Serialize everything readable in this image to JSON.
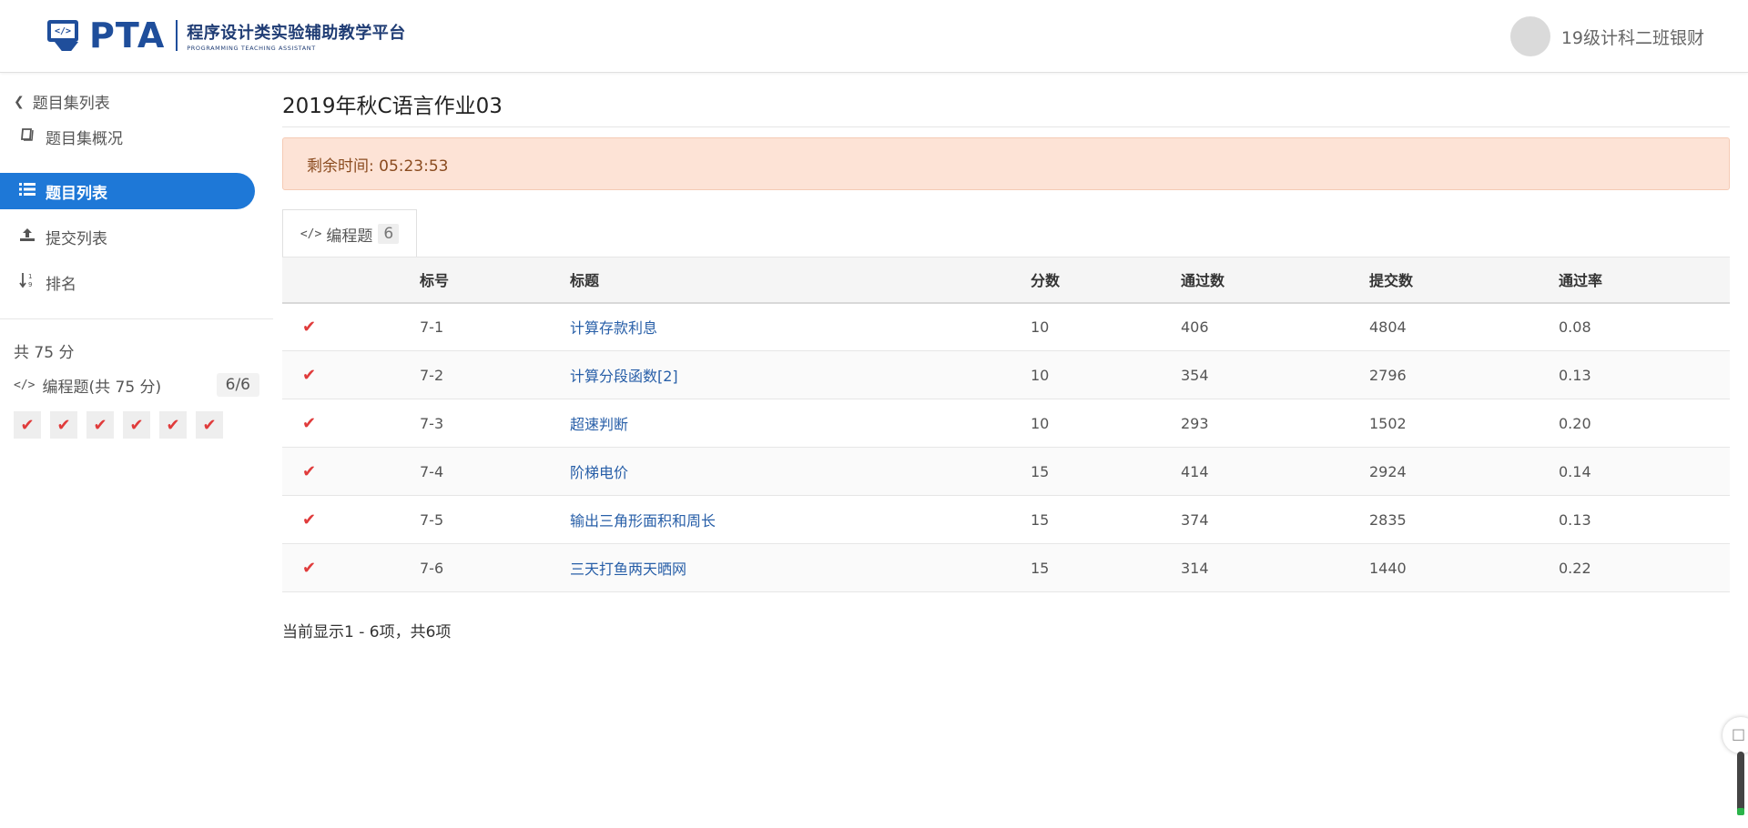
{
  "header": {
    "logo_text": "PTA",
    "logo_cn": "程序设计类实验辅助教学平台",
    "logo_en": "PROGRAMMING TEACHING ASSISTANT",
    "logo_code": "</>",
    "username": "19级计科二班银财"
  },
  "sidebar": {
    "back_label": "题目集列表",
    "items": [
      {
        "label": "题目集概况",
        "icon": "book-icon"
      },
      {
        "label": "题目列表",
        "icon": "list-icon",
        "active": true
      },
      {
        "label": "提交列表",
        "icon": "upload-icon"
      },
      {
        "label": "排名",
        "icon": "sort-icon"
      }
    ],
    "total_score": "共 75 分",
    "group": {
      "code": "</>",
      "label": "编程题(共 75 分)",
      "count": "6/6"
    },
    "check_mark": "✔"
  },
  "main": {
    "title": "2019年秋C语言作业03",
    "timer": "剩余时间: 05:23:53",
    "tab": {
      "code": "</>",
      "label": "编程题",
      "count": "6"
    },
    "columns": [
      "标号",
      "标题",
      "分数",
      "通过数",
      "提交数",
      "通过率"
    ],
    "rows": [
      {
        "check": "✔",
        "num": "7-1",
        "title": "计算存款利息",
        "score": "10",
        "passed": "406",
        "submitted": "4804",
        "rate": "0.08"
      },
      {
        "check": "✔",
        "num": "7-2",
        "title": "计算分段函数[2]",
        "score": "10",
        "passed": "354",
        "submitted": "2796",
        "rate": "0.13"
      },
      {
        "check": "✔",
        "num": "7-3",
        "title": "超速判断",
        "score": "10",
        "passed": "293",
        "submitted": "1502",
        "rate": "0.20"
      },
      {
        "check": "✔",
        "num": "7-4",
        "title": "阶梯电价",
        "score": "15",
        "passed": "414",
        "submitted": "2924",
        "rate": "0.14"
      },
      {
        "check": "✔",
        "num": "7-5",
        "title": "输出三角形面积和周长",
        "score": "15",
        "passed": "374",
        "submitted": "2835",
        "rate": "0.13"
      },
      {
        "check": "✔",
        "num": "7-6",
        "title": "三天打鱼两天晒网",
        "score": "15",
        "passed": "314",
        "submitted": "1440",
        "rate": "0.22"
      }
    ],
    "pager_info": "当前显示1 - 6项，共6项"
  },
  "colors": {
    "accent": "#1e78d7",
    "check": "#e03b3b",
    "timer_bg": "#fde3d6",
    "link": "#285fa8"
  }
}
